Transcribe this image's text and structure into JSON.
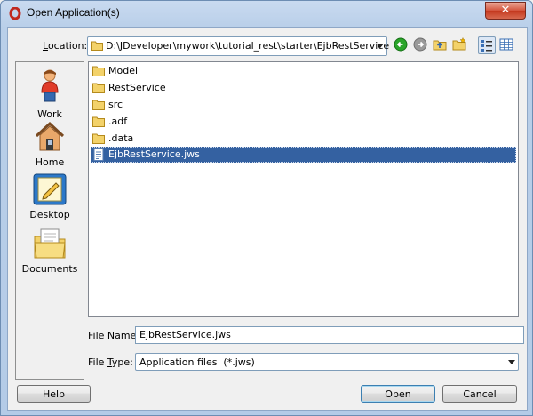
{
  "window": {
    "title": "Open Application(s)"
  },
  "location": {
    "label": "Location:",
    "value": "D:\\JDeveloper\\mywork\\tutorial_rest\\starter\\EjbRestService"
  },
  "places": [
    {
      "label": "Work",
      "icon": "user-icon"
    },
    {
      "label": "Home",
      "icon": "home-icon"
    },
    {
      "label": "Desktop",
      "icon": "desktop-icon"
    },
    {
      "label": "Documents",
      "icon": "documents-icon"
    }
  ],
  "files": [
    {
      "name": "Model",
      "kind": "folder"
    },
    {
      "name": "RestService",
      "kind": "folder"
    },
    {
      "name": "src",
      "kind": "folder"
    },
    {
      "name": ".adf",
      "kind": "folder"
    },
    {
      "name": ".data",
      "kind": "folder"
    },
    {
      "name": "EjbRestService.jws",
      "kind": "file",
      "selected": true
    }
  ],
  "file_name": {
    "label_prefix": "F",
    "label_rest": "ile Name:",
    "value": "EjbRestService.jws"
  },
  "file_type": {
    "label_prefix": "File ",
    "label_u": "T",
    "label_rest": "ype:",
    "value": "Application files  (*.jws)"
  },
  "buttons": {
    "help": "Help",
    "open": "Open",
    "cancel": "Cancel"
  },
  "colors": {
    "selection": "#3461a1",
    "titlebar": "#c9daf0",
    "close": "#c4381e"
  }
}
